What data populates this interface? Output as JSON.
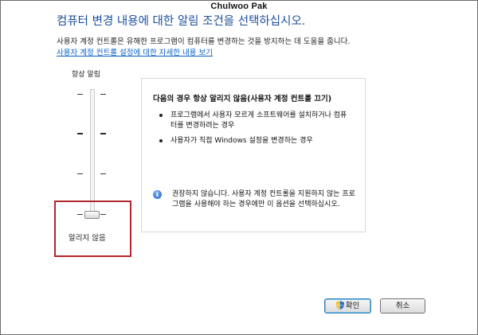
{
  "watermark": "Chulwoo Pak",
  "header": {
    "title": "컴퓨터 변경 내용에 대한 알림 조건을 선택하십시오.",
    "description": "사용자 계정 컨트롤은 유해한 프로그램이 컴퓨터를 변경하는 것을 방지하는 데 도움을 줍니다.",
    "learn_more_link": "사용자 계정 컨트롤 설정에 대한 자세한 내용 보기"
  },
  "slider": {
    "top_label": "항상 알림",
    "bottom_label": "알리지 않음",
    "levels": 4,
    "selected_level": 1
  },
  "info_panel": {
    "heading": "다음의 경우 항상 알리지 않음(사용자 계정 컨트롤 끄기)",
    "bullets": [
      "프로그램에서 사용자 모르게 소프트웨어를 설치하거나 컴퓨터를 변경하려는 경우",
      "사용자가 직접 Windows 설정을 변경하는 경우"
    ],
    "note_icon": "info-icon",
    "note": "권장하지 않습니다. 사용자 계정 컨트롤을 지원하지 않는 프로그램을 사용해야 하는 경우에만 이 옵션을 선택하십시오."
  },
  "buttons": {
    "ok_label": "확인",
    "ok_icon": "shield-icon",
    "cancel_label": "취소"
  },
  "colors": {
    "title": "#1c4f9c",
    "link": "#0a63c9",
    "highlight": "#b3262b"
  }
}
